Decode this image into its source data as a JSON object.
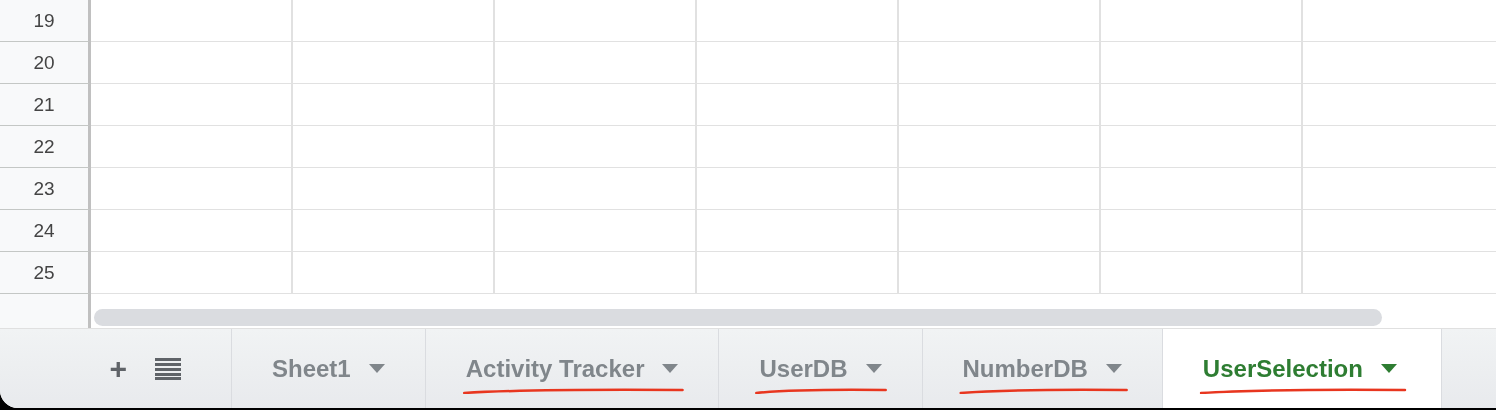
{
  "grid": {
    "row_numbers": [
      "19",
      "20",
      "21",
      "22",
      "23",
      "24",
      "25"
    ]
  },
  "sheet_bar": {
    "add_label": "+",
    "tabs": [
      {
        "label": "Sheet1",
        "selected": false,
        "underlined": false
      },
      {
        "label": "Activity Tracker",
        "selected": false,
        "underlined": true
      },
      {
        "label": "UserDB",
        "selected": false,
        "underlined": true
      },
      {
        "label": "NumberDB",
        "selected": false,
        "underlined": true
      },
      {
        "label": "UserSelection",
        "selected": true,
        "underlined": true
      }
    ]
  }
}
